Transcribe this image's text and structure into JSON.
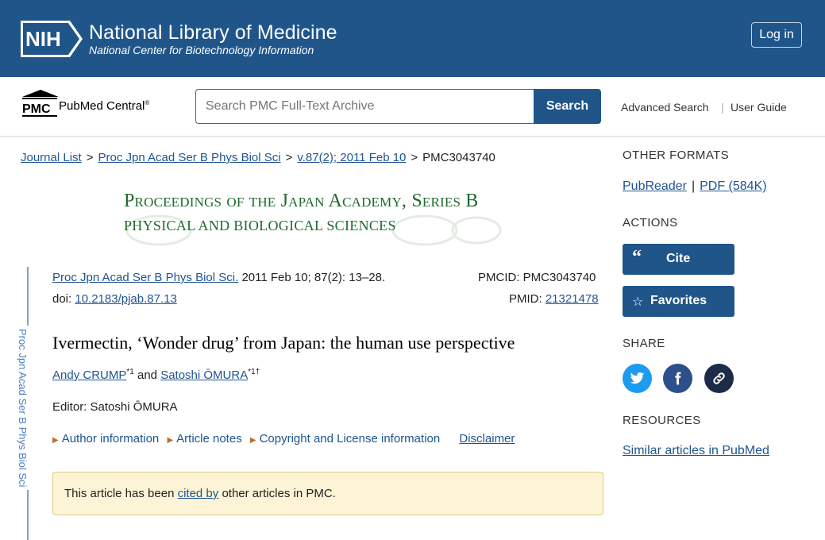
{
  "header": {
    "logo_text": "NIH",
    "title": "National Library of Medicine",
    "subtitle": "National Center for Biotechnology Information",
    "login_label": "Log in"
  },
  "pmc_bar": {
    "logo_text": "PMC",
    "brand": "PubMed Central",
    "brand_mark": "®",
    "search_placeholder": "Search PMC Full-Text Archive",
    "search_button": "Search",
    "advanced_search": "Advanced Search",
    "separator": "|",
    "user_guide": "User Guide"
  },
  "breadcrumb": {
    "items": [
      "Journal List",
      "Proc Jpn Acad Ser B Phys Biol Sci",
      "v.87(2); 2011 Feb 10"
    ],
    "separator": ">",
    "current": "PMC3043740"
  },
  "journal_banner": {
    "line1": "Proceedings of the Japan Academy, Series B",
    "line2": "PHYSICAL AND BIOLOGICAL SCIENCES"
  },
  "side_label": "Proc Jpn Acad Ser B Phys Biol Sci",
  "article": {
    "journal_link": "Proc Jpn Acad Ser B Phys Biol Sci.",
    "citation": " 2011 Feb 10; 87(2): 13–28.",
    "doi_label": "doi: ",
    "doi": "10.2183/pjab.87.13",
    "pmcid": "PMCID: PMC3043740",
    "pmid_label": "PMID: ",
    "pmid": "21321478",
    "title": "Ivermectin, ‘Wonder drug’ from Japan: the human use perspective",
    "author1": "Andy CRUMP",
    "author1_sup": "*1",
    "and": " and ",
    "author2": "Satoshi ŌMURA",
    "author2_sup": "*1†",
    "editor": "Editor: Satoshi ŌMURA",
    "links": [
      "Author information",
      "Article notes",
      "Copyright and License information"
    ],
    "disclaimer": "Disclaimer",
    "notice_pre": "This article has been ",
    "notice_link": "cited by",
    "notice_post": " other articles in PMC."
  },
  "sidebar": {
    "other_formats_heading": "OTHER FORMATS",
    "pubreader": "PubReader",
    "formats_sep": "|",
    "pdf": "PDF (584K)",
    "actions_heading": "ACTIONS",
    "cite_label": "Cite",
    "favorites_label": "Favorites",
    "share_heading": "SHARE",
    "resources_heading": "RESOURCES",
    "similar_articles": "Similar articles in PubMed"
  },
  "colors": {
    "nih_blue": "#20558a",
    "link_blue": "#205493",
    "journal_green": "#1f6a2c",
    "notice_bg": "#fdf4d7",
    "twitter": "#1d9bf0",
    "facebook": "#2d4f8c",
    "link_share": "#1b2b48"
  }
}
